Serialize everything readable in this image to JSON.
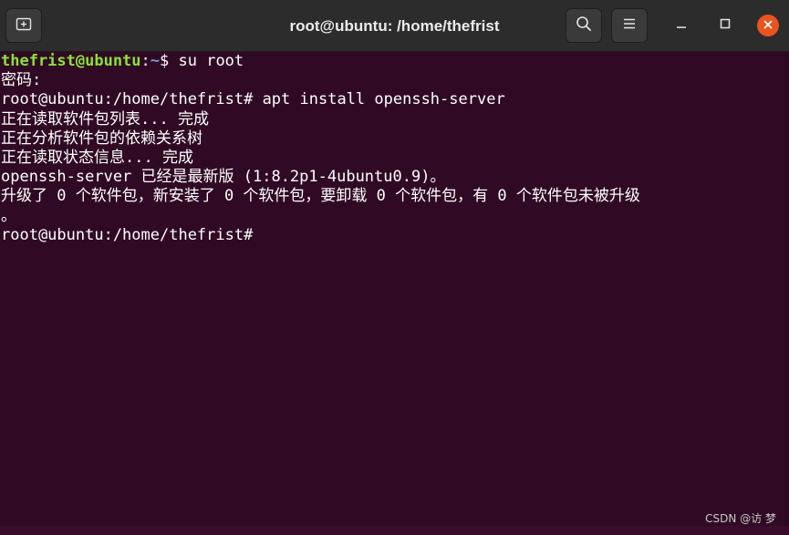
{
  "window": {
    "title": "root@ubuntu: /home/thefrist"
  },
  "titlebar": {
    "new_tab_icon": "new-tab-icon",
    "search_icon": "search-icon",
    "menu_icon": "hamburger-menu-icon",
    "minimize_icon": "minimize-icon",
    "maximize_icon": "maximize-icon",
    "close_icon": "close-icon"
  },
  "colors": {
    "terminal_background": "#300a24",
    "prompt_user_host": "#8ae234",
    "prompt_path": "#729fcf",
    "close_button": "#e95420"
  },
  "terminal": {
    "line1": {
      "user_host": "thefrist@ubuntu",
      "colon": ":",
      "path": "~",
      "rest": "$ su root"
    },
    "line2": "密码:",
    "line3": "root@ubuntu:/home/thefrist# apt install openssh-server",
    "line4": "正在读取软件包列表... 完成",
    "line5": "正在分析软件包的依赖关系树",
    "line6": "正在读取状态信息... 完成",
    "line7": "openssh-server 已经是最新版 (1:8.2p1-4ubuntu0.9)。",
    "line8": "升级了 0 个软件包，新安装了 0 个软件包，要卸载 0 个软件包，有 0 个软件包未被升级",
    "line9": "。",
    "line10": "root@ubuntu:/home/thefrist#"
  },
  "watermark": "CSDN @访 梦"
}
